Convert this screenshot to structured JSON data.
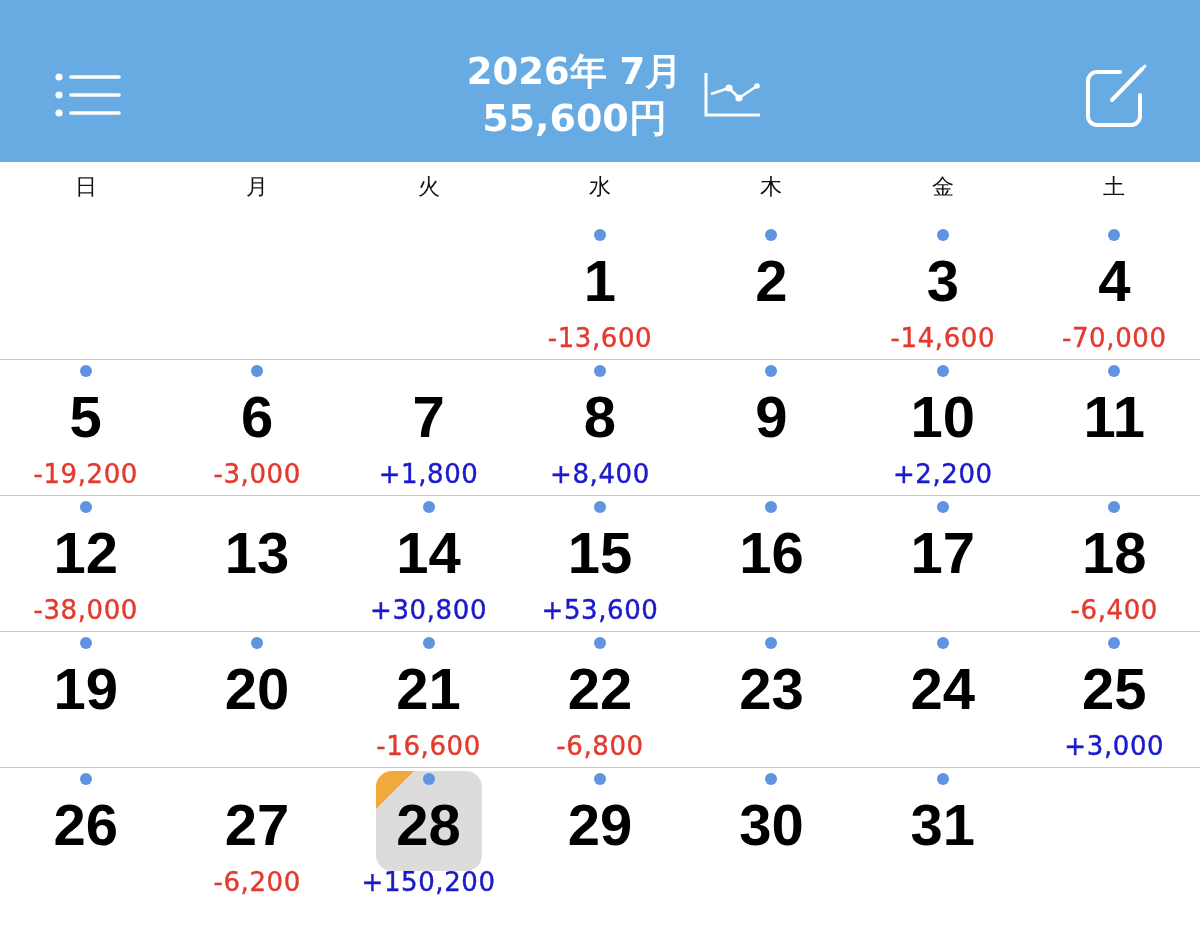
{
  "header": {
    "title": "2026年 7月",
    "total": "55,600円"
  },
  "weekdays": [
    "日",
    "月",
    "火",
    "水",
    "木",
    "金",
    "土"
  ],
  "weeks": [
    [
      {
        "kind": "blank"
      },
      {
        "kind": "blank"
      },
      {
        "kind": "blank"
      },
      {
        "kind": "day",
        "day": "1",
        "dot": true,
        "selected": false,
        "today": false,
        "amount": {
          "text": "-13,600",
          "income": false
        }
      },
      {
        "kind": "day",
        "day": "2",
        "dot": true,
        "selected": false,
        "today": false
      },
      {
        "kind": "day",
        "day": "3",
        "dot": true,
        "selected": false,
        "today": false,
        "amount": {
          "text": "-14,600",
          "income": false
        }
      },
      {
        "kind": "day",
        "day": "4",
        "dot": true,
        "selected": false,
        "today": false,
        "amount": {
          "text": "-70,000",
          "income": false
        }
      }
    ],
    [
      {
        "kind": "day",
        "day": "5",
        "dot": true,
        "selected": false,
        "today": false,
        "amount": {
          "text": "-19,200",
          "income": false
        }
      },
      {
        "kind": "day",
        "day": "6",
        "dot": true,
        "selected": false,
        "today": false,
        "amount": {
          "text": "-3,000",
          "income": false
        }
      },
      {
        "kind": "day",
        "day": "7",
        "dot": false,
        "selected": false,
        "today": false,
        "amount": {
          "text": "+1,800",
          "income": true
        }
      },
      {
        "kind": "day",
        "day": "8",
        "dot": true,
        "selected": false,
        "today": false,
        "amount": {
          "text": "+8,400",
          "income": true
        }
      },
      {
        "kind": "day",
        "day": "9",
        "dot": true,
        "selected": false,
        "today": false
      },
      {
        "kind": "day",
        "day": "10",
        "dot": true,
        "selected": false,
        "today": false,
        "amount": {
          "text": "+2,200",
          "income": true
        }
      },
      {
        "kind": "day",
        "day": "11",
        "dot": true,
        "selected": false,
        "today": false
      }
    ],
    [
      {
        "kind": "day",
        "day": "12",
        "dot": true,
        "selected": false,
        "today": false,
        "amount": {
          "text": "-38,000",
          "income": false
        }
      },
      {
        "kind": "day",
        "day": "13",
        "dot": false,
        "selected": false,
        "today": false
      },
      {
        "kind": "day",
        "day": "14",
        "dot": true,
        "selected": false,
        "today": false,
        "amount": {
          "text": "+30,800",
          "income": true
        }
      },
      {
        "kind": "day",
        "day": "15",
        "dot": true,
        "selected": false,
        "today": false,
        "amount": {
          "text": "+53,600",
          "income": true
        }
      },
      {
        "kind": "day",
        "day": "16",
        "dot": true,
        "selected": false,
        "today": false
      },
      {
        "kind": "day",
        "day": "17",
        "dot": true,
        "selected": false,
        "today": false
      },
      {
        "kind": "day",
        "day": "18",
        "dot": true,
        "selected": false,
        "today": false,
        "amount": {
          "text": "-6,400",
          "income": false
        }
      }
    ],
    [
      {
        "kind": "day",
        "day": "19",
        "dot": true,
        "selected": false,
        "today": false
      },
      {
        "kind": "day",
        "day": "20",
        "dot": true,
        "selected": false,
        "today": false
      },
      {
        "kind": "day",
        "day": "21",
        "dot": true,
        "selected": false,
        "today": false,
        "amount": {
          "text": "-16,600",
          "income": false
        }
      },
      {
        "kind": "day",
        "day": "22",
        "dot": true,
        "selected": false,
        "today": false,
        "amount": {
          "text": "-6,800",
          "income": false
        }
      },
      {
        "kind": "day",
        "day": "23",
        "dot": true,
        "selected": false,
        "today": false
      },
      {
        "kind": "day",
        "day": "24",
        "dot": true,
        "selected": false,
        "today": false
      },
      {
        "kind": "day",
        "day": "25",
        "dot": true,
        "selected": false,
        "today": false,
        "amount": {
          "text": "+3,000",
          "income": true
        }
      }
    ],
    [
      {
        "kind": "day",
        "day": "26",
        "dot": true,
        "selected": false,
        "today": false
      },
      {
        "kind": "day",
        "day": "27",
        "dot": false,
        "selected": false,
        "today": false,
        "amount": {
          "text": "-6,200",
          "income": false
        }
      },
      {
        "kind": "day",
        "day": "28",
        "dot": true,
        "selected": true,
        "today": true,
        "amount": {
          "text": "+150,200",
          "income": true
        }
      },
      {
        "kind": "day",
        "day": "29",
        "dot": true,
        "selected": false,
        "today": false
      },
      {
        "kind": "day",
        "day": "30",
        "dot": true,
        "selected": false,
        "today": false
      },
      {
        "kind": "day",
        "day": "31",
        "dot": true,
        "selected": false,
        "today": false
      },
      {
        "kind": "blank"
      }
    ]
  ]
}
